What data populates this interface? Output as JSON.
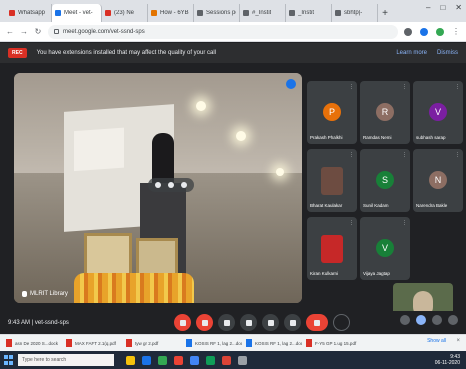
{
  "browser": {
    "tabs": [
      {
        "label": "Whatsapp",
        "color": "#d93025"
      },
      {
        "label": "Meet - vet-",
        "color": "#1a73e8",
        "active": true
      },
      {
        "label": "(23) Ne",
        "color": "#d93025"
      },
      {
        "label": "How - 6YBTN",
        "color": "#e37400"
      },
      {
        "label": "Sessions pdf",
        "color": "#5f6368"
      },
      {
        "label": "#_Instit",
        "color": "#5f6368"
      },
      {
        "label": "_Instit",
        "color": "#5f6368"
      },
      {
        "label": "sbhtp|-",
        "color": "#5f6368"
      }
    ],
    "new_tab": "+",
    "url": "meet.google.com/vet-ssnd-sps"
  },
  "banner": {
    "rec": "REC",
    "message": "You have extensions installed that may affect the quality of your call",
    "learn_more": "Learn more",
    "dismiss": "Dismiss"
  },
  "presenter": {
    "name": "MLRIT Library"
  },
  "participants": [
    {
      "name": "Prakash Phalkhi",
      "initial": "P",
      "color": "#e8710a",
      "kind": "avatar"
    },
    {
      "name": "Ramdas Nemi",
      "initial": "R",
      "color": "#8d6e63",
      "kind": "avatar"
    },
    {
      "name": "subhash sarap",
      "initial": "V",
      "color": "#7b1fa2",
      "kind": "avatar"
    },
    {
      "name": "Bharat Kaulakar",
      "initial": "",
      "color": "#6d4c41",
      "kind": "photo"
    },
    {
      "name": "Sunil Kadam",
      "initial": "S",
      "color": "#188038",
      "kind": "avatar"
    },
    {
      "name": "Narendra Bakle",
      "initial": "N",
      "color": "#8d6e63",
      "kind": "avatar"
    },
    {
      "name": "Kiran Kulkarni",
      "initial": "",
      "color": "#c62828",
      "kind": "photo"
    },
    {
      "name": "Vijaya Jagtap",
      "initial": "V",
      "color": "#188038",
      "kind": "avatar"
    }
  ],
  "self_view": {
    "label": "You"
  },
  "controls": {
    "meeting_info": "9:43 AM  |  vet-ssnd-sps"
  },
  "downloads": [
    {
      "name": "asn De 2020 S...dock",
      "type": "pdf"
    },
    {
      "name": "MAX FAFT 2.1(q.pdf",
      "type": "pdf"
    },
    {
      "name": "tyw gr 2.pdf",
      "type": "pdf"
    },
    {
      "name": "KOSIS RF 1, lag 2...docx",
      "type": "doc"
    },
    {
      "name": "KOSIS RF 1, lag 2...docx",
      "type": "doc"
    },
    {
      "name": "F-Y5 GP 1.ug 15.pdf",
      "type": "pdf"
    }
  ],
  "shelf": {
    "show_all": "Show all",
    "close": "×"
  },
  "taskbar": {
    "search_placeholder": "Type here to search",
    "time": "9:43",
    "date": "06-11-2020"
  }
}
